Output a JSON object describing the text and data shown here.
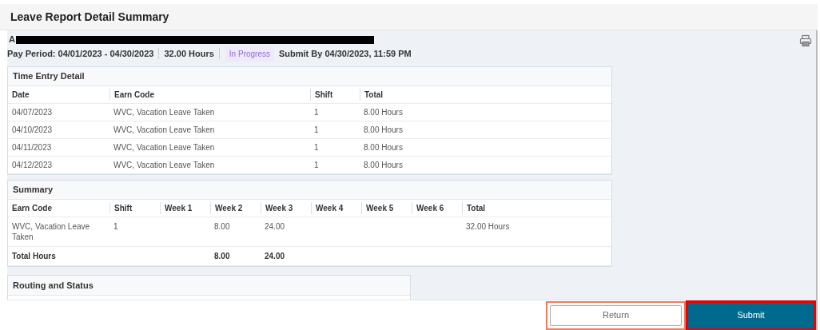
{
  "title": "Leave Report Detail Summary",
  "employee_line": {
    "prefix": "A"
  },
  "pay_period": "Pay Period: 04/01/2023 - 04/30/2023",
  "hours": "32.00 Hours",
  "status": "In Progress",
  "submit_by": "Submit By 04/30/2023, 11:59 PM",
  "time_entry": {
    "title": "Time Entry Detail",
    "columns": [
      "Date",
      "Earn Code",
      "Shift",
      "Total"
    ],
    "rows": [
      [
        "04/07/2023",
        "WVC, Vacation Leave Taken",
        "1",
        "8.00 Hours"
      ],
      [
        "04/10/2023",
        "WVC, Vacation Leave Taken",
        "1",
        "8.00 Hours"
      ],
      [
        "04/11/2023",
        "WVC, Vacation Leave Taken",
        "1",
        "8.00 Hours"
      ],
      [
        "04/12/2023",
        "WVC, Vacation Leave Taken",
        "1",
        "8.00 Hours"
      ]
    ]
  },
  "summary": {
    "title": "Summary",
    "columns": [
      "Earn Code",
      "Shift",
      "Week 1",
      "Week 2",
      "Week 3",
      "Week 4",
      "Week 5",
      "Week 6",
      "Total"
    ],
    "rows": [
      {
        "earn_code": "WVC, Vacation Leave Taken",
        "shift": "1",
        "week_2": "8.00",
        "week_3": "24.00",
        "total": "32.00 Hours"
      }
    ],
    "total_row": {
      "earn_code": "Total Hours",
      "week_2": "8.00",
      "week_3": "24.00"
    }
  },
  "routing": {
    "title": "Routing and Status"
  },
  "buttons": [
    {
      "label": "Return",
      "kind": "secondary"
    },
    {
      "label": "Submit",
      "kind": "primary"
    }
  ]
}
